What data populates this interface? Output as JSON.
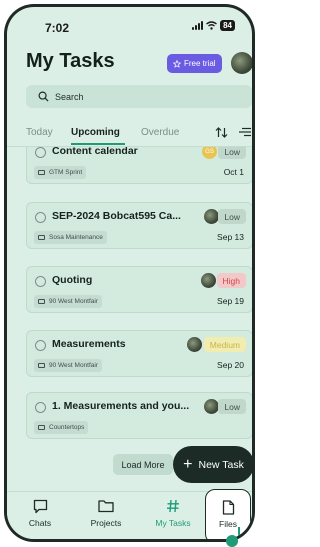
{
  "status_bar": {
    "time": "7:02",
    "battery": "84"
  },
  "header": {
    "title": "My Tasks",
    "trial_label": "Free trial"
  },
  "search": {
    "label": "Search"
  },
  "tabs": [
    {
      "label": "Today",
      "active": false
    },
    {
      "label": "Upcoming",
      "active": true
    },
    {
      "label": "Overdue",
      "active": false
    }
  ],
  "tasks": [
    {
      "name": "Content calendar",
      "assignee": "photo",
      "initials": "GS",
      "priority": "Low",
      "project": "GTM Sprint",
      "date": "Oct 1"
    },
    {
      "name": "SEP-2024 Bobcat595 Ca...",
      "assignee": "photo",
      "priority": "Low",
      "project": "Sosa Maintenance",
      "date": "Sep 13"
    },
    {
      "name": "Quoting",
      "assignee": "photo",
      "priority": "High",
      "project": "90 West Montfair",
      "date": "Sep 19"
    },
    {
      "name": "Measurements",
      "assignee": "photo",
      "priority": "Medium",
      "project": "90 West Montfair",
      "date": "Sep 20"
    },
    {
      "name": "1. Measurements and you...",
      "assignee": "photo",
      "priority": "Low",
      "project": "Countertops",
      "date": ""
    }
  ],
  "actions": {
    "load_more": "Load More",
    "new_task": "New Task"
  },
  "nav": [
    {
      "label": "Chats",
      "icon": "chat-icon"
    },
    {
      "label": "Projects",
      "icon": "folder-icon"
    },
    {
      "label": "My Tasks",
      "icon": "hash-icon",
      "active": true
    },
    {
      "label": "Files",
      "icon": "file-icon"
    }
  ],
  "colors": {
    "accent": "#1f9b78",
    "trial": "#6a5be3",
    "background": "#dcefe6"
  }
}
